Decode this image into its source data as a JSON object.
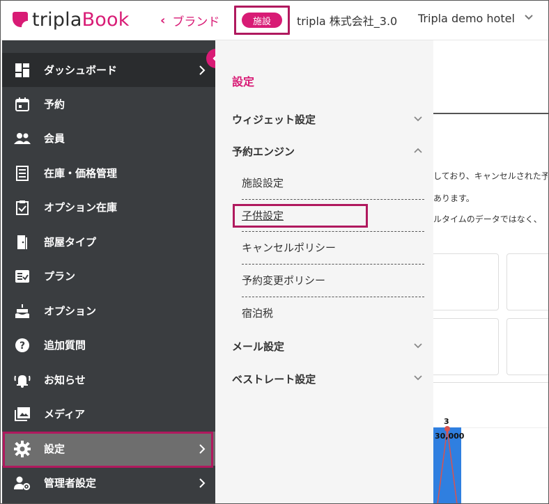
{
  "header": {
    "logo_left": "tripla",
    "logo_right": "Book",
    "brand_link": "ブランド",
    "facility_badge": "施設",
    "company": "tripla 株式会社_3.0",
    "hotel": "Tripla demo hotel"
  },
  "sidebar": {
    "items": [
      {
        "label": "ダッシュボード"
      },
      {
        "label": "予約"
      },
      {
        "label": "会員"
      },
      {
        "label": "在庫・価格管理"
      },
      {
        "label": "オプション在庫"
      },
      {
        "label": "部屋タイプ"
      },
      {
        "label": "プラン"
      },
      {
        "label": "オプション"
      },
      {
        "label": "追加質問"
      },
      {
        "label": "お知らせ"
      },
      {
        "label": "メディア"
      },
      {
        "label": "設定"
      },
      {
        "label": "管理者設定"
      }
    ]
  },
  "flyout": {
    "title": "設定",
    "sections": [
      {
        "label": "ウィジェット設定"
      },
      {
        "label": "予約エンジン"
      },
      {
        "label": "メール設定"
      },
      {
        "label": "ベストレート設定"
      }
    ],
    "subitems": [
      {
        "label": "施設設定"
      },
      {
        "label": "子供設定"
      },
      {
        "label": "キャンセルポリシー"
      },
      {
        "label": "予約変更ポリシー"
      },
      {
        "label": "宿泊税"
      }
    ]
  },
  "main": {
    "line1": "しており、キャンセルされた予",
    "line2": "あります。",
    "line3": "ルタイムのデータではなく、",
    "chart_top": "3",
    "chart_value": "30,000"
  },
  "colors": {
    "accent": "#d81b75",
    "sidebar_bg": "#3a3d40",
    "highlight_frame": "#b0195e"
  }
}
